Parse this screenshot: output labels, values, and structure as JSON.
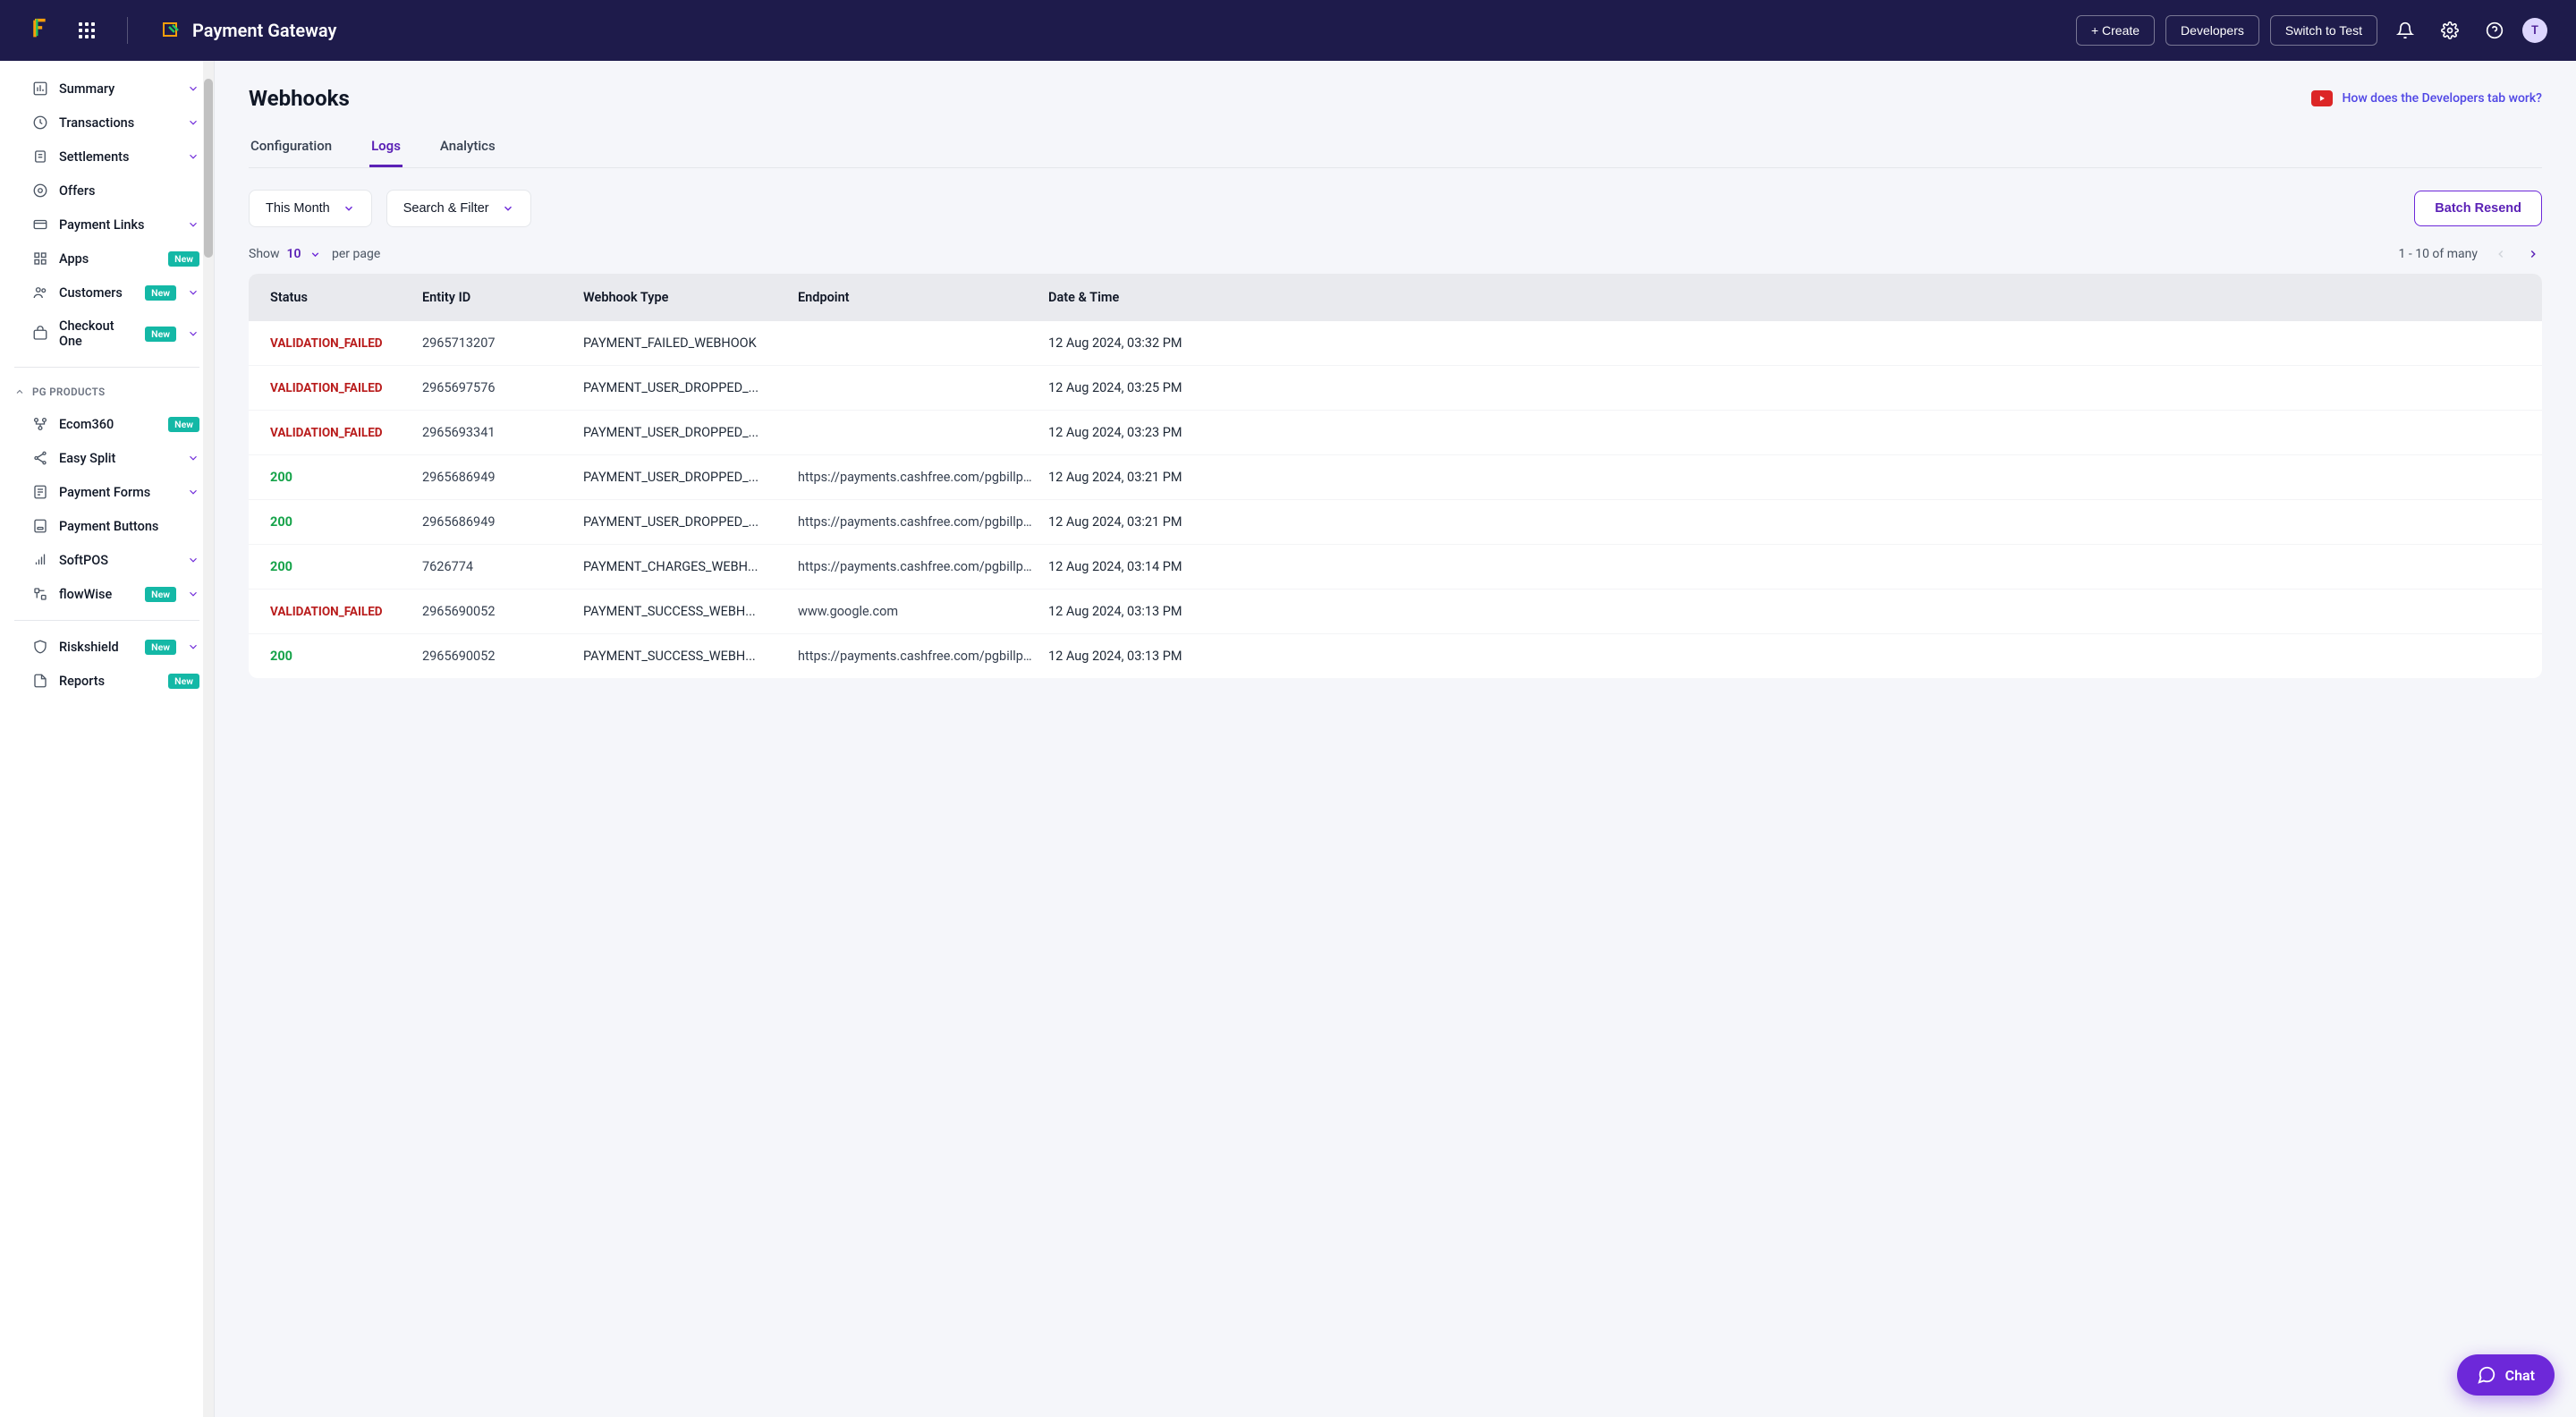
{
  "header": {
    "product_name": "Payment Gateway",
    "create_btn": "+ Create",
    "developers_btn": "Developers",
    "switch_btn": "Switch to Test",
    "avatar_initial": "T"
  },
  "sidebar": {
    "items": [
      {
        "icon": "bar-chart",
        "label": "Summary",
        "chevron": true
      },
      {
        "icon": "repeat",
        "label": "Transactions",
        "chevron": true
      },
      {
        "icon": "clipboard",
        "label": "Settlements",
        "chevron": true
      },
      {
        "icon": "tag",
        "label": "Offers",
        "chevron": false
      },
      {
        "icon": "link",
        "label": "Payment Links",
        "chevron": true
      },
      {
        "icon": "grid",
        "label": "Apps",
        "badge": "New",
        "chevron": false
      },
      {
        "icon": "users",
        "label": "Customers",
        "badge": "New",
        "chevron": true
      },
      {
        "icon": "cart",
        "label": "Checkout One",
        "badge": "New",
        "chevron": true
      }
    ],
    "section_label": "PG PRODUCTS",
    "section_items": [
      {
        "icon": "branch",
        "label": "Ecom360",
        "badge": "New",
        "chevron": false
      },
      {
        "icon": "split",
        "label": "Easy Split",
        "chevron": true
      },
      {
        "icon": "form",
        "label": "Payment Forms",
        "chevron": true
      },
      {
        "icon": "button",
        "label": "Payment Buttons",
        "chevron": false
      },
      {
        "icon": "signal",
        "label": "SoftPOS",
        "chevron": true
      },
      {
        "icon": "flow",
        "label": "flowWise",
        "badge": "New",
        "chevron": true
      }
    ],
    "bottom_items": [
      {
        "icon": "shield",
        "label": "Riskshield",
        "badge": "New",
        "chevron": true
      },
      {
        "icon": "file",
        "label": "Reports",
        "badge": "New",
        "chevron": false
      }
    ]
  },
  "page": {
    "title": "Webhooks",
    "help_text": "How does the Developers tab work?",
    "tabs": [
      "Configuration",
      "Logs",
      "Analytics"
    ],
    "active_tab": 1,
    "date_filter": "This Month",
    "search_filter": "Search & Filter",
    "batch_resend": "Batch Resend",
    "show_label": "Show",
    "per_page": "10",
    "per_page_suffix": "per page",
    "pager_text": "1 - 10 of many"
  },
  "table": {
    "columns": [
      "Status",
      "Entity ID",
      "Webhook Type",
      "Endpoint",
      "Date & Time"
    ],
    "rows": [
      {
        "status": "VALIDATION_FAILED",
        "status_type": "failed",
        "entity_id": "2965713207",
        "webhook_type": "PAYMENT_FAILED_WEBHOOK",
        "endpoint": "",
        "datetime": "12 Aug 2024, 03:32 PM"
      },
      {
        "status": "VALIDATION_FAILED",
        "status_type": "failed",
        "entity_id": "2965697576",
        "webhook_type": "PAYMENT_USER_DROPPED_...",
        "endpoint": "",
        "datetime": "12 Aug 2024, 03:25 PM"
      },
      {
        "status": "VALIDATION_FAILED",
        "status_type": "failed",
        "entity_id": "2965693341",
        "webhook_type": "PAYMENT_USER_DROPPED_...",
        "endpoint": "",
        "datetime": "12 Aug 2024, 03:23 PM"
      },
      {
        "status": "200",
        "status_type": "ok",
        "entity_id": "2965686949",
        "webhook_type": "PAYMENT_USER_DROPPED_...",
        "endpoint": "https://payments.cashfree.com/pgbillpa...",
        "datetime": "12 Aug 2024, 03:21 PM"
      },
      {
        "status": "200",
        "status_type": "ok",
        "entity_id": "2965686949",
        "webhook_type": "PAYMENT_USER_DROPPED_...",
        "endpoint": "https://payments.cashfree.com/pgbillpa...",
        "datetime": "12 Aug 2024, 03:21 PM"
      },
      {
        "status": "200",
        "status_type": "ok",
        "entity_id": "7626774",
        "webhook_type": "PAYMENT_CHARGES_WEBH...",
        "endpoint": "https://payments.cashfree.com/pgbillpa...",
        "datetime": "12 Aug 2024, 03:14 PM"
      },
      {
        "status": "VALIDATION_FAILED",
        "status_type": "failed",
        "entity_id": "2965690052",
        "webhook_type": "PAYMENT_SUCCESS_WEBH...",
        "endpoint": "www.google.com",
        "datetime": "12 Aug 2024, 03:13 PM"
      },
      {
        "status": "200",
        "status_type": "ok",
        "entity_id": "2965690052",
        "webhook_type": "PAYMENT_SUCCESS_WEBH...",
        "endpoint": "https://payments.cashfree.com/pgbillpa...",
        "datetime": "12 Aug 2024, 03:13 PM"
      }
    ]
  },
  "chat_fab": "Chat"
}
